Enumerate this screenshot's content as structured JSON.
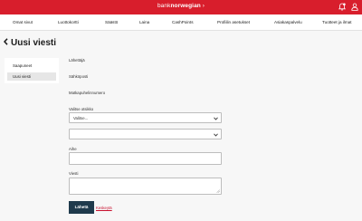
{
  "header": {
    "brand_light": "bank",
    "brand_bold": "norwegian",
    "brand_arrow": "›",
    "icons": [
      "notification-icon",
      "user-icon"
    ],
    "color": "#d81e2c"
  },
  "nav": {
    "items": [
      "Omat sivut",
      "Luottokortti",
      "Säästö",
      "Laina",
      "CashPoints",
      "Profiilin asetukset",
      "Asiakaspalvelu",
      "Tuotteet ja ilmat"
    ]
  },
  "page": {
    "title": "Uusi viesti"
  },
  "sidebar": {
    "items": [
      "Saapuneet",
      "Uusi viesti"
    ]
  },
  "form": {
    "sender_label": "Lähettäjä",
    "email_label": "Sähköposti",
    "phone_label": "Matkapuhelinnumero",
    "topic_label": "Valitse otsikko",
    "topic_value": "Valitse...",
    "subject_label": "Aihe",
    "message_label": "Viesti",
    "send_label": "Lähetä",
    "cancel_label": "Keskeytä"
  }
}
